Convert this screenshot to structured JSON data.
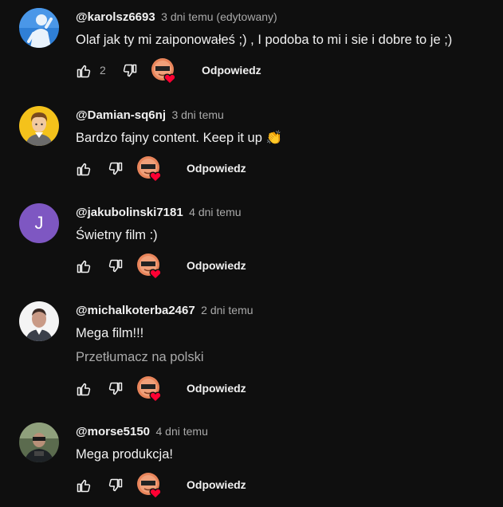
{
  "comments": [
    {
      "handle": "@karolsz6693",
      "time": "3 dni temu (edytowany)",
      "text": "Olaf jak ty mi zaiponowałeś ;) , I podoba to mi i sie i dobre to je ;)",
      "likes": "2",
      "reply_label": "Odpowiedz",
      "avatar_icon": "cartoon-figure-avatar"
    },
    {
      "handle": "@Damian-sq6nj",
      "time": "3 dni temu",
      "text": "Bardzo fajny content. Keep it up 👏",
      "reply_label": "Odpowiedz",
      "avatar_icon": "default-user-avatar"
    },
    {
      "handle": "@jakubolinski7181",
      "time": "4 dni temu",
      "text": "Świetny film :)",
      "reply_label": "Odpowiedz",
      "avatar_letter": "J",
      "avatar_color": "#7e57c2"
    },
    {
      "handle": "@michalkoterba2467",
      "time": "2 dni temu",
      "text": "Mega film!!!",
      "translate": "Przetłumacz na polski",
      "reply_label": "Odpowiedz",
      "avatar_icon": "photo-avatar"
    },
    {
      "handle": "@morse5150",
      "time": "4 dni temu",
      "text": "Mega produkcja!",
      "reply_label": "Odpowiedz",
      "avatar_icon": "photo-avatar"
    }
  ],
  "colors": {
    "background": "#0f0f0f",
    "text": "#f1f1f1",
    "muted": "#aaaaaa",
    "heart": "#ff0033"
  }
}
